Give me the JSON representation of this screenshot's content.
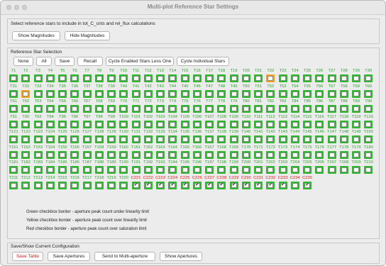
{
  "window": {
    "title": "Multi-plot Reference Star Settings"
  },
  "select_section": {
    "instruction": "Select reference stars to include in tot_C_cnts and rel_flux calculations",
    "show_magnitudes": "Show Magnitudes",
    "hide_magnitudes": "Hide Magnitudes"
  },
  "ref_section": {
    "caption": "Reference Star Selection",
    "buttons": {
      "none": "None",
      "all": "All",
      "save": "Save",
      "recall": "Recall",
      "cycle_less_one": "Cycle Enabled Stars Less One",
      "cycle_individual": "Cycle Individual Stars"
    }
  },
  "stars": {
    "t_count": 220,
    "c_labels": [
      "C221",
      "C222",
      "C223",
      "C224",
      "C225",
      "C226",
      "C227",
      "C228",
      "C229",
      "C230",
      "C231",
      "C232",
      "C233",
      "C234",
      "C235"
    ],
    "yellow_border": [
      "T22",
      "T32"
    ],
    "checked": [
      "C221",
      "C222",
      "C223",
      "C224",
      "C225",
      "C226",
      "C227",
      "C228",
      "C229",
      "C230",
      "C231",
      "C232",
      "C233",
      "C235"
    ],
    "colors": {
      "green": "#2eb82e",
      "yellow": "#f2a21c",
      "red": "#e01818",
      "t_label": "#2a9d2a"
    }
  },
  "legend": {
    "green": "Green checkbox border - aperture peak count under linearity limit",
    "yellow": "Yellow checkbox border - aperture peak count over linearity limit",
    "red": "Red checkbox border - aperture peak count over saturation limit"
  },
  "config_section": {
    "caption": "Save/Show Current Configuration",
    "save_table": "Save Table",
    "save_apertures": "Save Apertures",
    "send_multi": "Send to Multi-aperture",
    "show_apertures": "Show Apertures"
  }
}
